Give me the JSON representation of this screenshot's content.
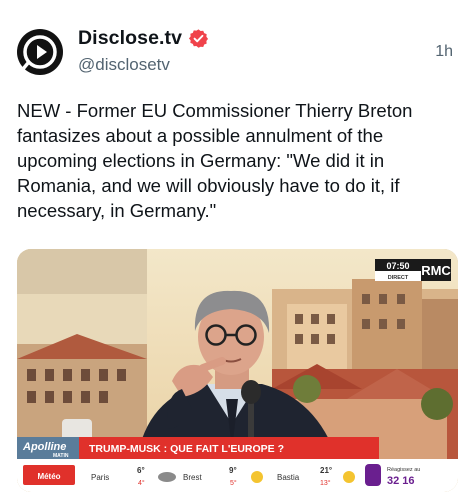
{
  "post": {
    "display_name": "Disclose.tv",
    "handle": "@disclosetv",
    "timestamp": "1h",
    "verified_icon": "verified-badge-icon",
    "text": "NEW - Former EU Commissioner Thierry Breton fantasizes about a possible annulment of the upcoming elections in Germany: \"We did it in Romania, and we will obviously have to do it, if necessary, in Germany.\""
  },
  "video": {
    "channel_logo": "RMC",
    "clock": "07:50",
    "live_label": "DIRECT",
    "show_logo": "Apolline",
    "show_logo_sub": "MATIN",
    "headline": "TRUMP-MUSK : QUE FAIT L'EUROPE ?",
    "weather": {
      "label": "Météo",
      "cities": [
        {
          "name": "Paris",
          "high": "6°",
          "low": "4°"
        },
        {
          "name": "Brest",
          "high": "9°",
          "low": "5°"
        },
        {
          "name": "Bastia",
          "high": "21°",
          "low": "13°"
        }
      ],
      "cta_top": "Réagissez au",
      "cta_number": "32 16"
    }
  },
  "colors": {
    "brand_red": "#e0312b",
    "verified": "#f0434b",
    "weather_bar": "#6a1f8f"
  }
}
